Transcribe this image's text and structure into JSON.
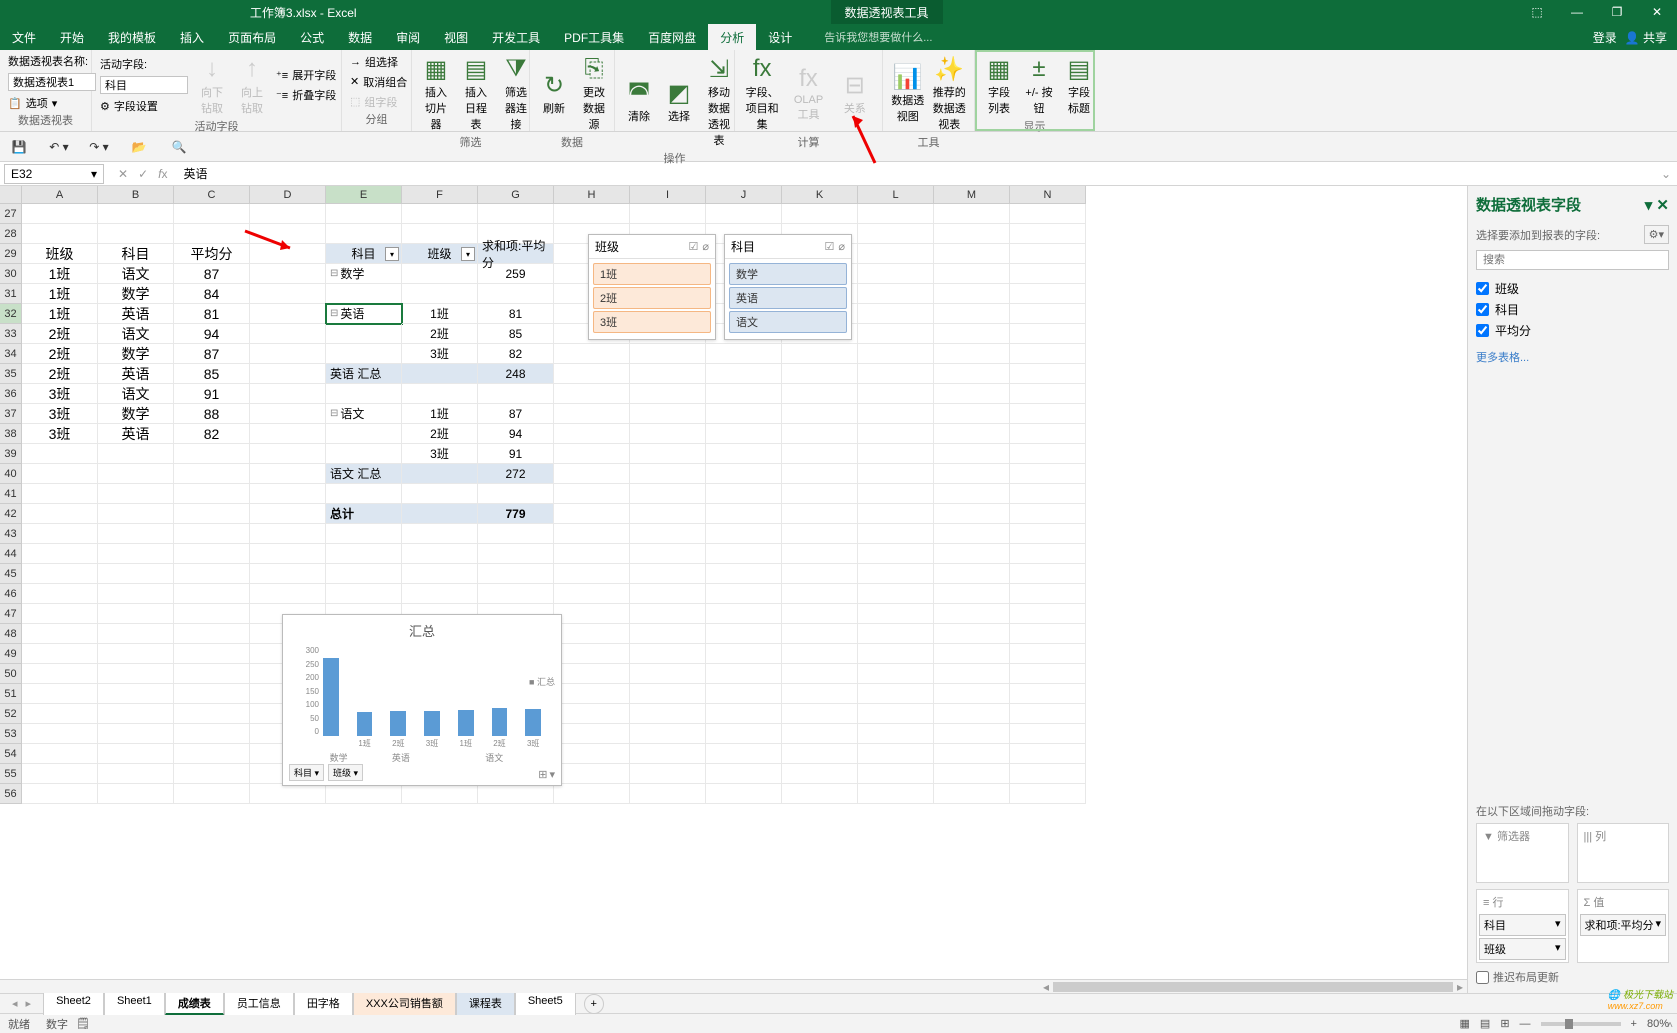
{
  "app": {
    "title": "工作簿3.xlsx - Excel",
    "context_tool": "数据透视表工具"
  },
  "window_controls": {
    "ribbon_opts": "⬚",
    "min": "—",
    "restore": "❐",
    "close": "✕"
  },
  "menutabs": {
    "items": [
      "文件",
      "开始",
      "我的模板",
      "插入",
      "页面布局",
      "公式",
      "数据",
      "审阅",
      "视图",
      "开发工具",
      "PDF工具集",
      "百度网盘",
      "分析",
      "设计"
    ],
    "active": "分析",
    "tellme": "告诉我您想要做什么...",
    "login": "登录",
    "share": "共享"
  },
  "ribbon": {
    "g_pivot_name": "数据透视表名称:",
    "pivot_name_val": "数据透视表1",
    "options": "选项",
    "g_pivot_lbl": "数据透视表",
    "g_active_field": "活动字段:",
    "active_field_val": "科目",
    "field_settings": "字段设置",
    "drill_down": "向下钻取",
    "drill_up": "向上钻取",
    "expand_field": "展开字段",
    "collapse_field": "折叠字段",
    "g_active_lbl": "活动字段",
    "group_sel": "组选择",
    "cancel_group": "取消组合",
    "group_field": "组字段",
    "g_group_lbl": "分组",
    "slicer": "插入切片器",
    "timeline": "插入日程表",
    "filter_conn": "筛选器连接",
    "g_filter_lbl": "筛选",
    "refresh": "刷新",
    "change_src": "更改数据源",
    "g_data_lbl": "数据",
    "clear": "清除",
    "select": "选择",
    "move": "移动数据透视表",
    "g_ops_lbl": "操作",
    "fields_items": "字段、项目和集",
    "olap": "OLAP 工具",
    "relations": "关系",
    "g_calc_lbl": "计算",
    "pivot_chart": "数据透视图",
    "recommend": "推荐的数据透视表",
    "g_tools_lbl": "工具",
    "field_list": "字段列表",
    "pm_buttons": "+/- 按钮",
    "field_headers": "字段标题",
    "g_display_lbl": "显示"
  },
  "fbar": {
    "name": "E32",
    "value": "英语"
  },
  "columns": [
    "A",
    "B",
    "C",
    "D",
    "E",
    "F",
    "G",
    "H",
    "I",
    "J",
    "K",
    "L",
    "M",
    "N"
  ],
  "rows_start": 27,
  "rows_end": 56,
  "src_data": {
    "headers": [
      "班级",
      "科目",
      "平均分"
    ],
    "rows": [
      [
        "1班",
        "语文",
        "87"
      ],
      [
        "1班",
        "数学",
        "84"
      ],
      [
        "1班",
        "英语",
        "81"
      ],
      [
        "2班",
        "语文",
        "94"
      ],
      [
        "2班",
        "数学",
        "87"
      ],
      [
        "2班",
        "英语",
        "85"
      ],
      [
        "3班",
        "语文",
        "91"
      ],
      [
        "3班",
        "数学",
        "88"
      ],
      [
        "3班",
        "英语",
        "82"
      ]
    ]
  },
  "pivot": {
    "col_subject": "科目",
    "col_class": "班级",
    "col_sum": "求和项:平均分",
    "r": [
      {
        "e": "数学",
        "f": "",
        "g": "259",
        "exp": "⊟"
      },
      {
        "e": "",
        "f": "",
        "g": ""
      },
      {
        "e": "英语",
        "f": "1班",
        "g": "81",
        "exp": "⊟",
        "active": true
      },
      {
        "e": "",
        "f": "2班",
        "g": "85"
      },
      {
        "e": "",
        "f": "3班",
        "g": "82"
      },
      {
        "e": "英语 汇总",
        "f": "",
        "g": "248",
        "sub": true
      },
      {
        "e": "",
        "f": "",
        "g": ""
      },
      {
        "e": "语文",
        "f": "1班",
        "g": "87",
        "exp": "⊟"
      },
      {
        "e": "",
        "f": "2班",
        "g": "94"
      },
      {
        "e": "",
        "f": "3班",
        "g": "91"
      },
      {
        "e": "语文 汇总",
        "f": "",
        "g": "272",
        "sub": true
      },
      {
        "e": "",
        "f": "",
        "g": ""
      },
      {
        "e": "总计",
        "f": "",
        "g": "779",
        "total": true
      }
    ]
  },
  "slicer1": {
    "title": "班级",
    "items": [
      "1班",
      "2班",
      "3班"
    ]
  },
  "slicer2": {
    "title": "科目",
    "items": [
      "数学",
      "英语",
      "语文"
    ]
  },
  "chart_data": {
    "type": "bar",
    "title": "汇总",
    "series_name": "汇总",
    "yticks": [
      "0",
      "50",
      "100",
      "150",
      "200",
      "250",
      "300"
    ],
    "ylim": [
      0,
      300
    ],
    "groups": [
      {
        "name": "数学",
        "bars": [
          {
            "label": "",
            "value": 259
          }
        ]
      },
      {
        "name": "英语",
        "bars": [
          {
            "label": "1班",
            "value": 81
          },
          {
            "label": "2班",
            "value": 85
          },
          {
            "label": "3班",
            "value": 82
          }
        ]
      },
      {
        "name": "语文",
        "bars": [
          {
            "label": "1班",
            "value": 87
          },
          {
            "label": "2班",
            "value": 94
          },
          {
            "label": "3班",
            "value": 91
          }
        ]
      }
    ],
    "filters": [
      "科目",
      "班级"
    ]
  },
  "fieldpanel": {
    "title": "数据透视表字段",
    "sub": "选择要添加到报表的字段:",
    "search_ph": "搜索",
    "fields": [
      "班级",
      "科目",
      "平均分"
    ],
    "more": "更多表格...",
    "zones_hdr": "在以下区域间拖动字段:",
    "z_filter": "筛选器",
    "z_col": "列",
    "z_row": "行",
    "z_val": "值",
    "row_items": [
      "科目",
      "班级"
    ],
    "val_items": [
      "求和项:平均分"
    ],
    "defer": "推迟布局更新"
  },
  "sheets": {
    "tabs": [
      "Sheet2",
      "Sheet1",
      "成绩表",
      "员工信息",
      "田字格",
      "XXX公司销售额",
      "课程表",
      "Sheet5"
    ],
    "active": "成绩表"
  },
  "status": {
    "ready": "就绪",
    "scroll": "数字",
    "zoom": "80%"
  },
  "watermark": {
    "l1": "极光下载站",
    "l2": "www.xz7.com"
  }
}
